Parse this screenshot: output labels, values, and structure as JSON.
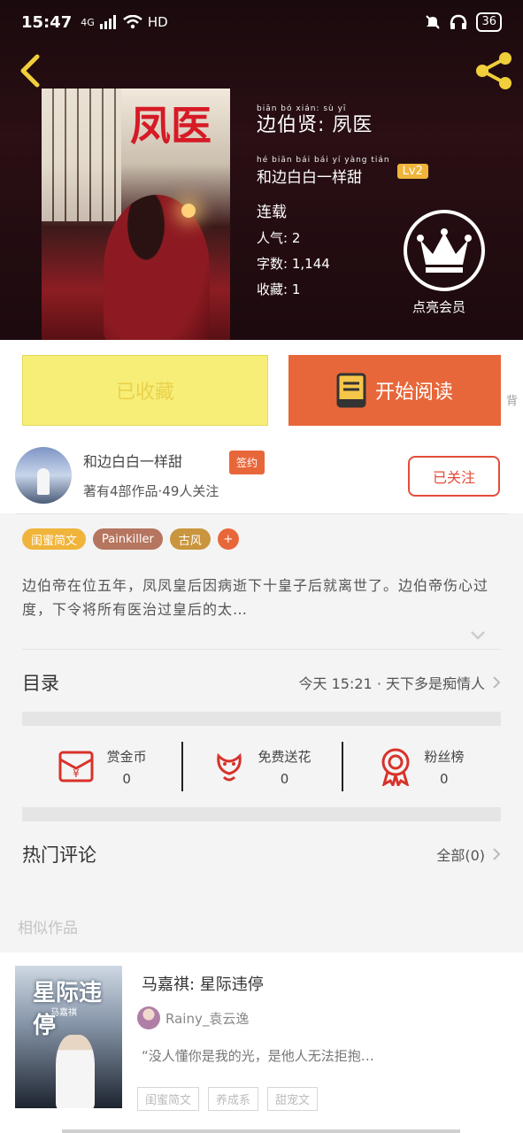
{
  "status_bar": {
    "time": "15:47",
    "network": "4G",
    "hd": "HD",
    "battery": "36"
  },
  "book": {
    "cover_title": "凤医",
    "title_pinyin": "biān bó xián: sù yī",
    "title": "边伯贤: 夙医",
    "author_pinyin": "hé biān bái bái yí yàng tián",
    "author": "和边白白一样甜",
    "level": "Lv2",
    "status": "连载",
    "popularity_label": "人气",
    "popularity": "2",
    "words_label": "字数",
    "words": "1,144",
    "favorites_label": "收藏",
    "favorites": "1",
    "rank_label": "点亮会员"
  },
  "actions": {
    "saved": "已收藏",
    "read": "开始阅读",
    "side_tab": "背"
  },
  "author_card": {
    "name": "和边白白一样甜",
    "badge": "签约",
    "meta": "著有4部作品·49人关注",
    "follow": "已关注"
  },
  "tags": [
    {
      "label": "闺蜜简文",
      "color": "#f0b43a"
    },
    {
      "label": "Painkiller",
      "color": "#b5755f"
    },
    {
      "label": "古风",
      "color": "#c9953e"
    }
  ],
  "tag_add": "+",
  "intro": "边伯帝在位五年，凤凤皇后因病逝下十皇子后就离世了。边伯帝伤心过度，下令将所有医治过皇后的太…",
  "catalog": {
    "title": "目录",
    "latest": "今天 15:21 · 天下多是痴情人"
  },
  "gifts": [
    {
      "name": "赏金币",
      "count": "0",
      "icon": "red-envelope-icon"
    },
    {
      "name": "免费送花",
      "count": "0",
      "icon": "flower-icon"
    },
    {
      "name": "粉丝榜",
      "count": "0",
      "icon": "medal-icon"
    }
  ],
  "comments": {
    "title": "热门评论",
    "all": "全部(0)"
  },
  "similar_label": "相似作品",
  "recommendation": {
    "cover_title": "星际违停",
    "cover_author": "马嘉祺",
    "title": "马嘉祺: 星际违停",
    "author": "Rainy_袁云逸",
    "quote": "“没人懂你是我的光，是他人无法拒抱…",
    "tags": [
      "闺蜜简文",
      "养成系",
      "甜宠文"
    ]
  },
  "colors": {
    "accent": "#e8673a",
    "saved_yellow": "#f7ee78",
    "follow_red": "#e34d3a"
  }
}
